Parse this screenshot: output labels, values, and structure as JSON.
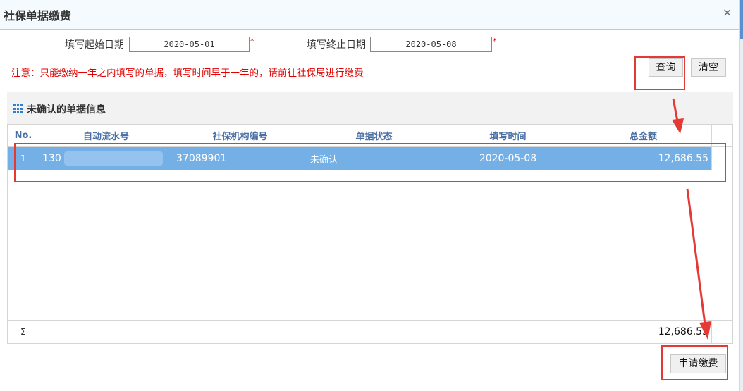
{
  "dialog": {
    "title": "社保单据缴费",
    "close_icon": "×"
  },
  "filters": {
    "start_label": "填写起始日期",
    "start_value": "2020-05-01",
    "end_label": "填写终止日期",
    "end_value": "2020-05-08",
    "required_mark": "*"
  },
  "notice": "注意：只能缴纳一年之内填写的单据，填写时间早于一年的，请前往社保局进行缴费",
  "buttons": {
    "query": "查询",
    "clear": "清空",
    "apply": "申请缴费"
  },
  "panel": {
    "title": "未确认的单据信息"
  },
  "table": {
    "columns": [
      "No.",
      "自动流水号",
      "社保机构编号",
      "单据状态",
      "填写时间",
      "总金额"
    ],
    "rows": [
      {
        "no": "1",
        "serial": "130",
        "org": "37089901",
        "status": "未确认",
        "time": "2020-05-08",
        "amount": "12,686.55"
      }
    ],
    "footer": {
      "sigma": "Σ",
      "total": "12,686.55"
    }
  },
  "colors": {
    "accent": "#74b0e6",
    "annotation": "#e53935",
    "notice": "#e00000"
  }
}
